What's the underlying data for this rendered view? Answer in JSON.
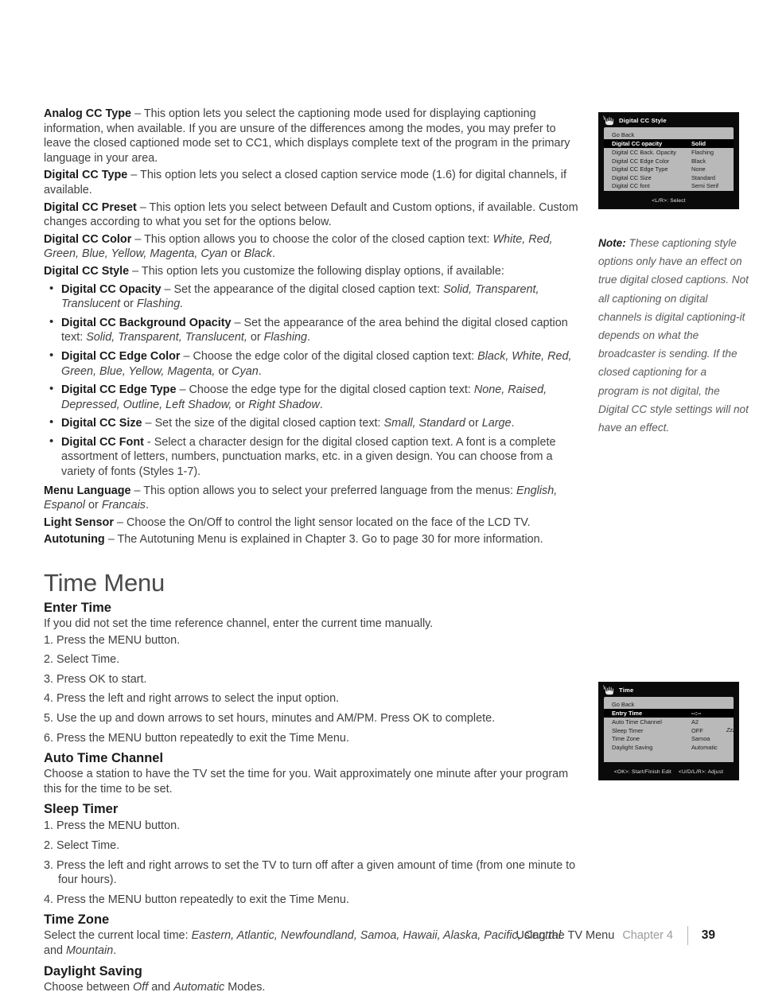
{
  "document": {
    "page_number": "39",
    "footer_label": "Using the TV Menu",
    "footer_chapter": "Chapter 4"
  },
  "cc_section": {
    "entries": [
      {
        "term": "Analog CC Type",
        "dash": " – ",
        "text": "This option lets you select the captioning mode used for displaying captioning information, when available. If you are unsure of the differences among the modes, you may prefer to leave the closed captioned mode set to CC1, which displays complete text of the program in the primary language in your area."
      },
      {
        "term": "Digital CC Type",
        "dash": " – ",
        "text": "This option lets you select a closed caption service mode (1.6) for digital channels, if available."
      },
      {
        "term": "Digital CC Preset",
        "dash": " – ",
        "text": "This option lets you select between Default and Custom options, if available. Custom changes according to what you set for the options below."
      }
    ],
    "color_entry": {
      "term": "Digital CC Color",
      "dash": " – ",
      "text_before": "This option allows you to choose the color of the closed caption text: ",
      "italic_list": "White, Red, Green, Blue, Yellow, Magenta, Cyan",
      "text_mid": " or ",
      "italic_last": "Black",
      "text_after": "."
    },
    "style_entry": {
      "term": "Digital CC Style",
      "dash": " – ",
      "text": "This option lets you customize the following display options, if available:"
    },
    "bullets": [
      {
        "term": "Digital CC Opacity",
        "dash": " – ",
        "text_before": "Set the appearance of the digital closed caption text: ",
        "italic_list": "Solid, Transparent, Translucent",
        "text_mid": " or ",
        "italic_last": "Flashing.",
        "text_after": ""
      },
      {
        "term": "Digital CC Background Opacity",
        "dash": " – ",
        "text_before": "Set the appearance of the area behind the digital closed caption text: ",
        "italic_list": "Solid, Transparent, Translucent,",
        "text_mid": " or ",
        "italic_last": "Flashing",
        "text_after": "."
      },
      {
        "term": "Digital CC Edge Color",
        "dash": " – ",
        "text_before": "Choose the edge color of the digital closed caption text: ",
        "italic_list": "Black, White, Red, Green, Blue, Yellow, Magenta,",
        "text_mid": " or ",
        "italic_last": "Cyan",
        "text_after": "."
      },
      {
        "term": "Digital CC Edge Type",
        "dash": " – ",
        "text_before": "Choose the edge type for the digital closed caption text: ",
        "italic_list": "None, Raised, Depressed, Outline, Left Shadow,",
        "text_mid": " or ",
        "italic_last": "Right Shadow",
        "text_after": "."
      },
      {
        "term": "Digital CC Size",
        "dash": " – ",
        "text_before": "Set the size of the digital closed caption text: ",
        "italic_list": "Small, Standard",
        "text_mid": " or ",
        "italic_last": "Large",
        "text_after": "."
      },
      {
        "term": "Digital CC Font",
        "dash": " - ",
        "text_before": "Select a character design for the digital closed caption text.  A font is a complete assortment of letters, numbers, punctuation marks, etc. in a given design. You can choose from a variety of fonts (Styles 1-7).",
        "italic_list": "",
        "text_mid": "",
        "italic_last": "",
        "text_after": ""
      }
    ],
    "menu_language": {
      "term": "Menu Language",
      "dash": " – ",
      "text_before": "This option allows you to select your preferred language from the menus: ",
      "italic_list": "English, Espanol",
      "text_mid": " or ",
      "italic_last": "Francais",
      "text_after": "."
    },
    "light_sensor": {
      "term": "Light Sensor",
      "dash": " – ",
      "text": "Choose the On/Off to control the light sensor located on the face of the LCD TV."
    },
    "autotuning": {
      "term": "Autotuning",
      "dash": " – ",
      "text": "The Autotuning Menu is explained in Chapter 3.  Go to page 30 for more information."
    }
  },
  "note": {
    "label": "Note:",
    "text": " These captioning style options only have an effect on true digital closed captions. Not all captioning on digital channels is digital captioning-it depends on what the broadcaster is sending. If the closed captioning for a program is not digital, the Digital CC style settings will not have an effect."
  },
  "osd_cc_style": {
    "title": "Digital CC Style",
    "rows": [
      {
        "label": "Go Back",
        "value": "",
        "value2": "",
        "selected": false
      },
      {
        "label": "Digital CC opacity",
        "value": "Solid",
        "value2": "",
        "selected": true
      },
      {
        "label": "Digital CC Back. Opacity",
        "value": "Flashing",
        "value2": "",
        "selected": false
      },
      {
        "label": "Digital CC Edge Color",
        "value": "Black",
        "value2": "",
        "selected": false
      },
      {
        "label": "Digital CC Edge Type",
        "value": "None",
        "value2": "",
        "selected": false
      },
      {
        "label": "Digital CC Size",
        "value": "Standard",
        "value2": "",
        "selected": false
      },
      {
        "label": "Digital CC font",
        "value": "Semi Serif",
        "value2": "",
        "selected": false
      }
    ],
    "footer": "<L/R>: Select"
  },
  "osd_time": {
    "title": "Time",
    "rows": [
      {
        "label": "Go Back",
        "value": "",
        "value2": "",
        "selected": false
      },
      {
        "label": "Entry Time",
        "value": "--:--",
        "value2": "",
        "selected": true
      },
      {
        "label": "Auto Time Channel",
        "value": "A2",
        "value2": "",
        "selected": false
      },
      {
        "label": "Sleep Timer",
        "value": "OFF",
        "value2": "Zzz",
        "selected": false
      },
      {
        "label": "Time Zone",
        "value": "Samoa",
        "value2": "",
        "selected": false
      },
      {
        "label": "Daylight Saving",
        "value": "Automatic",
        "value2": "",
        "selected": false
      }
    ],
    "footer_left": "<OK>: Start/Finish Edit",
    "footer_right": "<U/D/L/R>: Adjust"
  },
  "time_menu": {
    "title": "Time Menu",
    "enter_time": {
      "heading": "Enter Time",
      "intro": "If you did not set the time reference channel, enter the current time manually.",
      "steps": [
        "1. Press the MENU button.",
        "2. Select Time.",
        "3. Press OK to start.",
        "4. Press the left and right arrows to select the input option.",
        "5. Use the up and down arrows to set hours, minutes and AM/PM.  Press OK to complete.",
        "6. Press the MENU button repeatedly to exit the Time Menu."
      ]
    },
    "auto_time_channel": {
      "heading": "Auto Time Channel",
      "text": "Choose a station to have the TV set the time for you.  Wait approximately one minute after your program this for the time to be set."
    },
    "sleep_timer": {
      "heading": "Sleep Timer",
      "steps": [
        "1. Press the MENU button.",
        "2. Select Time.",
        "3. Press the left and right arrows to set the TV to turn off after a given amount of time (from one minute to",
        "4. Press the MENU button repeatedly to exit the Time Menu."
      ],
      "step3_cont": "four hours)."
    },
    "time_zone": {
      "heading": "Time Zone",
      "text_before": "Select the current local time: ",
      "italic_list": "Eastern, Atlantic, Newfoundland, Samoa, Hawaii, Alaska, Pacific, Central",
      "text_mid": " and ",
      "italic_last": "Mountain",
      "text_after": "."
    },
    "daylight_saving": {
      "heading": "Daylight Saving",
      "text_before": "Choose between ",
      "italic_first": "Off",
      "text_mid": " and ",
      "italic_last": "Automatic",
      "text_after": " Modes."
    }
  }
}
